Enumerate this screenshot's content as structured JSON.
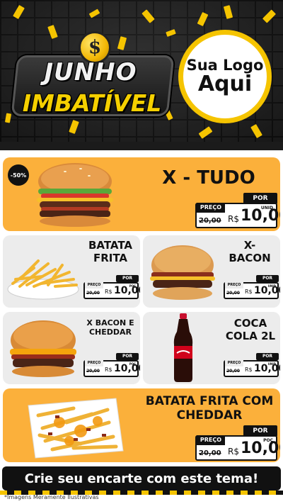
{
  "header": {
    "coin_symbol": "$",
    "title_line1": "JUNHO",
    "title_line2": "IMBATÍVEL",
    "logo_line1": "Sua Logo",
    "logo_line2": "Aqui"
  },
  "colors": {
    "accent_yellow": "#f5c400",
    "card_orange": "#fbb03b",
    "card_grey": "#ececec",
    "dark": "#111111"
  },
  "products": [
    {
      "id": "x-tudo",
      "name": "X - TUDO",
      "badge": "-50%",
      "price_label": "PREÇO",
      "old_price": "20,00",
      "currency": "R$",
      "price": "10,00",
      "por": "POR",
      "unit": "UNID"
    },
    {
      "id": "batata-frita",
      "name": "BATATA FRITA",
      "price_label": "PREÇO",
      "old_price": "20,00",
      "currency": "R$",
      "price": "10,00",
      "por": "POR",
      "unit": "POÇ"
    },
    {
      "id": "x-bacon",
      "name": "X- BACON",
      "price_label": "PREÇO",
      "old_price": "20,00",
      "currency": "R$",
      "price": "10,00",
      "por": "POR",
      "unit": "UNID"
    },
    {
      "id": "x-bacon-cheddar",
      "name": "X BACON E CHEDDAR",
      "price_label": "PREÇO",
      "old_price": "20,00",
      "currency": "R$",
      "price": "10,00",
      "por": "POR",
      "unit": "POÇ"
    },
    {
      "id": "coca-cola",
      "name": "COCA COLA 2L",
      "price_label": "PREÇO",
      "old_price": "20,00",
      "currency": "R$",
      "price": "10,00",
      "por": "POR",
      "unit": "UNID"
    },
    {
      "id": "batata-cheddar",
      "name": "BATATA FRITA COM CHEDDAR",
      "price_label": "PREÇO",
      "old_price": "20,00",
      "currency": "R$",
      "price": "10,00",
      "por": "POR",
      "unit": "POÇ"
    }
  ],
  "footer": {
    "cta": "Crie seu encarte com este tema!",
    "disclaimer": "*Imagens Meramente Ilustrativas"
  },
  "icons": [
    "dollar-coin-icon",
    "burger-image",
    "fries-image",
    "cola-bottle-image",
    "cheddar-fries-image"
  ]
}
